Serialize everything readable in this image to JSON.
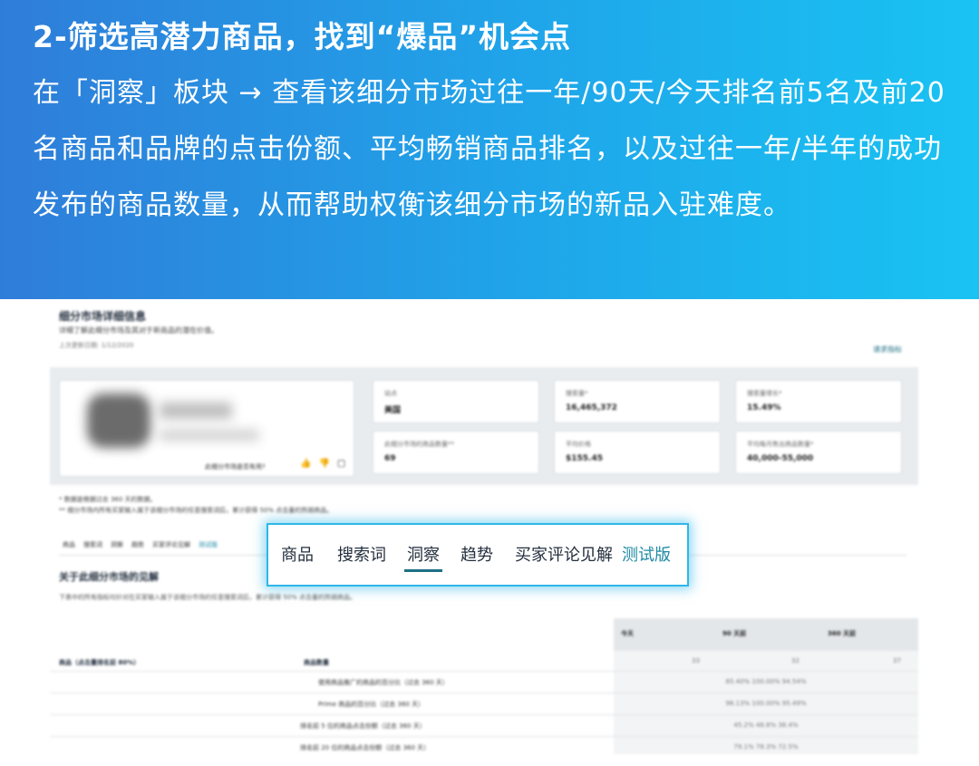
{
  "banner": {
    "title": "2-筛选高潜力商品，找到“爆品”机会点",
    "body": "在「洞察」板块 → 查看该细分市场过往一年/90天/今天排名前5名及前20名商品和品牌的点击份额、平均畅销商品排名，以及过往一年/半年的成功发布的商品数量，从而帮助权衡该细分市场的新品入驻难度。"
  },
  "screenshot": {
    "title": "细分市场详细信息",
    "description": "详细了解此细分市场及其对于新商品的潜在价值。",
    "updated": "上次更新日期: 1/12/2020",
    "link": "请求指标",
    "feedback_question": "此细分市场是否有用?",
    "feedback_icons": [
      "thumbs-up-icon",
      "thumbs-down-icon",
      "comment-icon"
    ],
    "metrics": [
      {
        "label": "站点",
        "value": "美国"
      },
      {
        "label": "搜索量*",
        "value": "16,465,372"
      },
      {
        "label": "搜索量增长*",
        "value": "15.49%"
      },
      {
        "label": "此细分市场的商品数量**",
        "value": "69"
      },
      {
        "label": "平均价格",
        "value": "$155.45"
      },
      {
        "label": "平均每月售出商品数量*",
        "value": "40,000-55,000"
      }
    ],
    "footnotes": [
      "* 数据是根据过去 360 天的数据。",
      "** 细分市场内所有买家输入属于该细分市场的任意搜索词后，累计获得 50% 点击量的热销商品。"
    ],
    "small_tabs": [
      "商品",
      "搜索词",
      "洞察",
      "趋势",
      "买家评论见解",
      "测试版"
    ],
    "section_title": "关于此细分市场的见解",
    "section_desc": "下表中的所有指标均针对在买家输入属于该细分市场的任意搜索词后，累计获得 50% 点击量的热销商品。",
    "table": {
      "headers": [
        "今天",
        "90 天前",
        "360 天前"
      ],
      "group_label": "商品（点击量排名前 80%）",
      "sub_label": "商品数量",
      "rows": [
        {
          "label": "",
          "values": [
            "33",
            "32",
            "37"
          ]
        },
        {
          "label": "使用商品推广的商品的百分比（过去 360 天）",
          "values": "85.40%|100.00%|94.54%"
        },
        {
          "label": "Prime 商品的百分比（过去 360 天）",
          "values": "96.13%|100.00%|95.49%"
        },
        {
          "label": "排名前 5 位的商品点击份额（过去 360 天）",
          "values": "45.2%|48.8%|38.4%"
        },
        {
          "label": "排名前 20 位的商品点击份额（过去 360 天）",
          "values": "79.1%|78.3%|72.5%"
        }
      ]
    }
  },
  "popup_tabs": {
    "tabs": [
      "商品",
      "搜索词",
      "洞察",
      "趋势",
      "买家评论见解"
    ],
    "beta": "测试版",
    "active": "洞察"
  }
}
